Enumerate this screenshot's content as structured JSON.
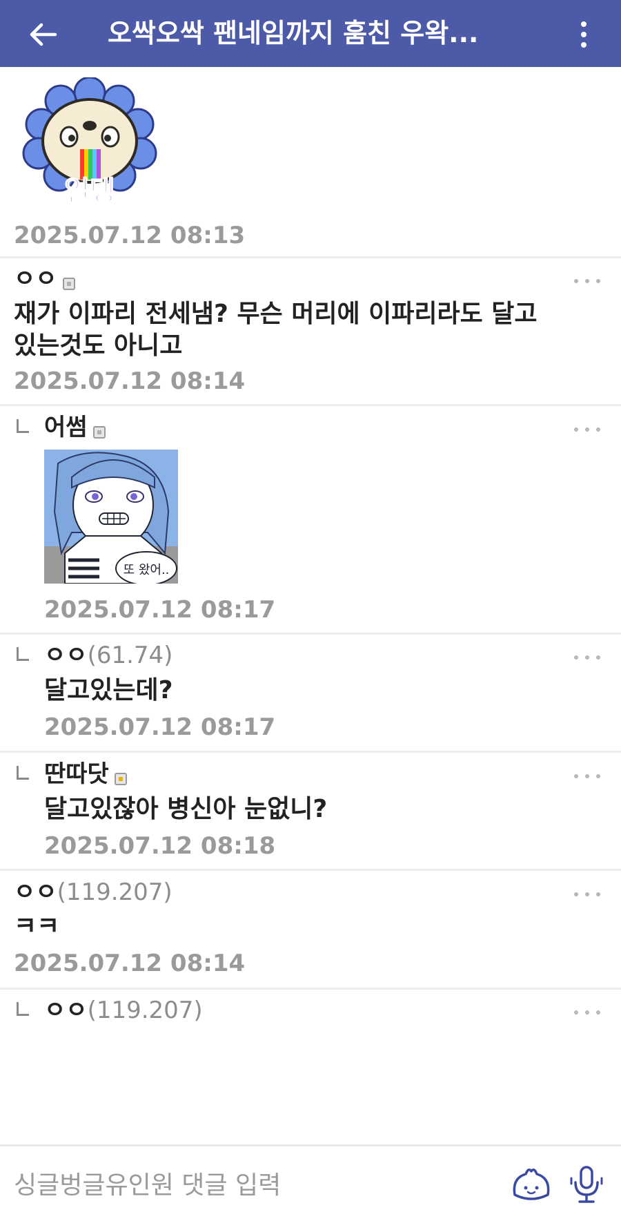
{
  "header": {
    "title": "오싹오싹 팬네임까지 훔친 우왁...",
    "back_icon": "arrow-left-icon",
    "menu_icon": "kebab-vertical-icon",
    "color": "#4d5aa8"
  },
  "comments": [
    {
      "type": "sticker",
      "sticker_caption": "얼탱",
      "time": "2025.07.12 08:13"
    },
    {
      "type": "comment",
      "nick": "ㅇㅇ",
      "body_lines": [
        "재가 이파리 전세냄? 무슨 머리에 이파리라도 달고",
        "있는것도 아니고"
      ],
      "time": "2025.07.12 08:14"
    },
    {
      "type": "reply",
      "nick": "어썸",
      "image_text": "또 왔어..",
      "time": "2025.07.12 08:17"
    },
    {
      "type": "reply",
      "nick": "ㅇㅇ",
      "ip": "(61.74)",
      "body": "달고있는데?",
      "time": "2025.07.12 08:17"
    },
    {
      "type": "reply",
      "nick": "딴따닷",
      "body": "달고있잖아 병신아 눈없니?",
      "time": "2025.07.12 08:18"
    },
    {
      "type": "comment",
      "nick": "ㅇㅇ",
      "ip": "(119.207)",
      "body": "ㅋㅋ",
      "time": "2025.07.12 08:14"
    },
    {
      "type": "reply",
      "nick": "ㅇㅇ",
      "ip": "(119.207)"
    }
  ],
  "input": {
    "placeholder": "싱글벙글유인원 댓글 입력",
    "emoji_icon": "dumpling-emoji-icon",
    "mic_icon": "microphone-icon"
  }
}
